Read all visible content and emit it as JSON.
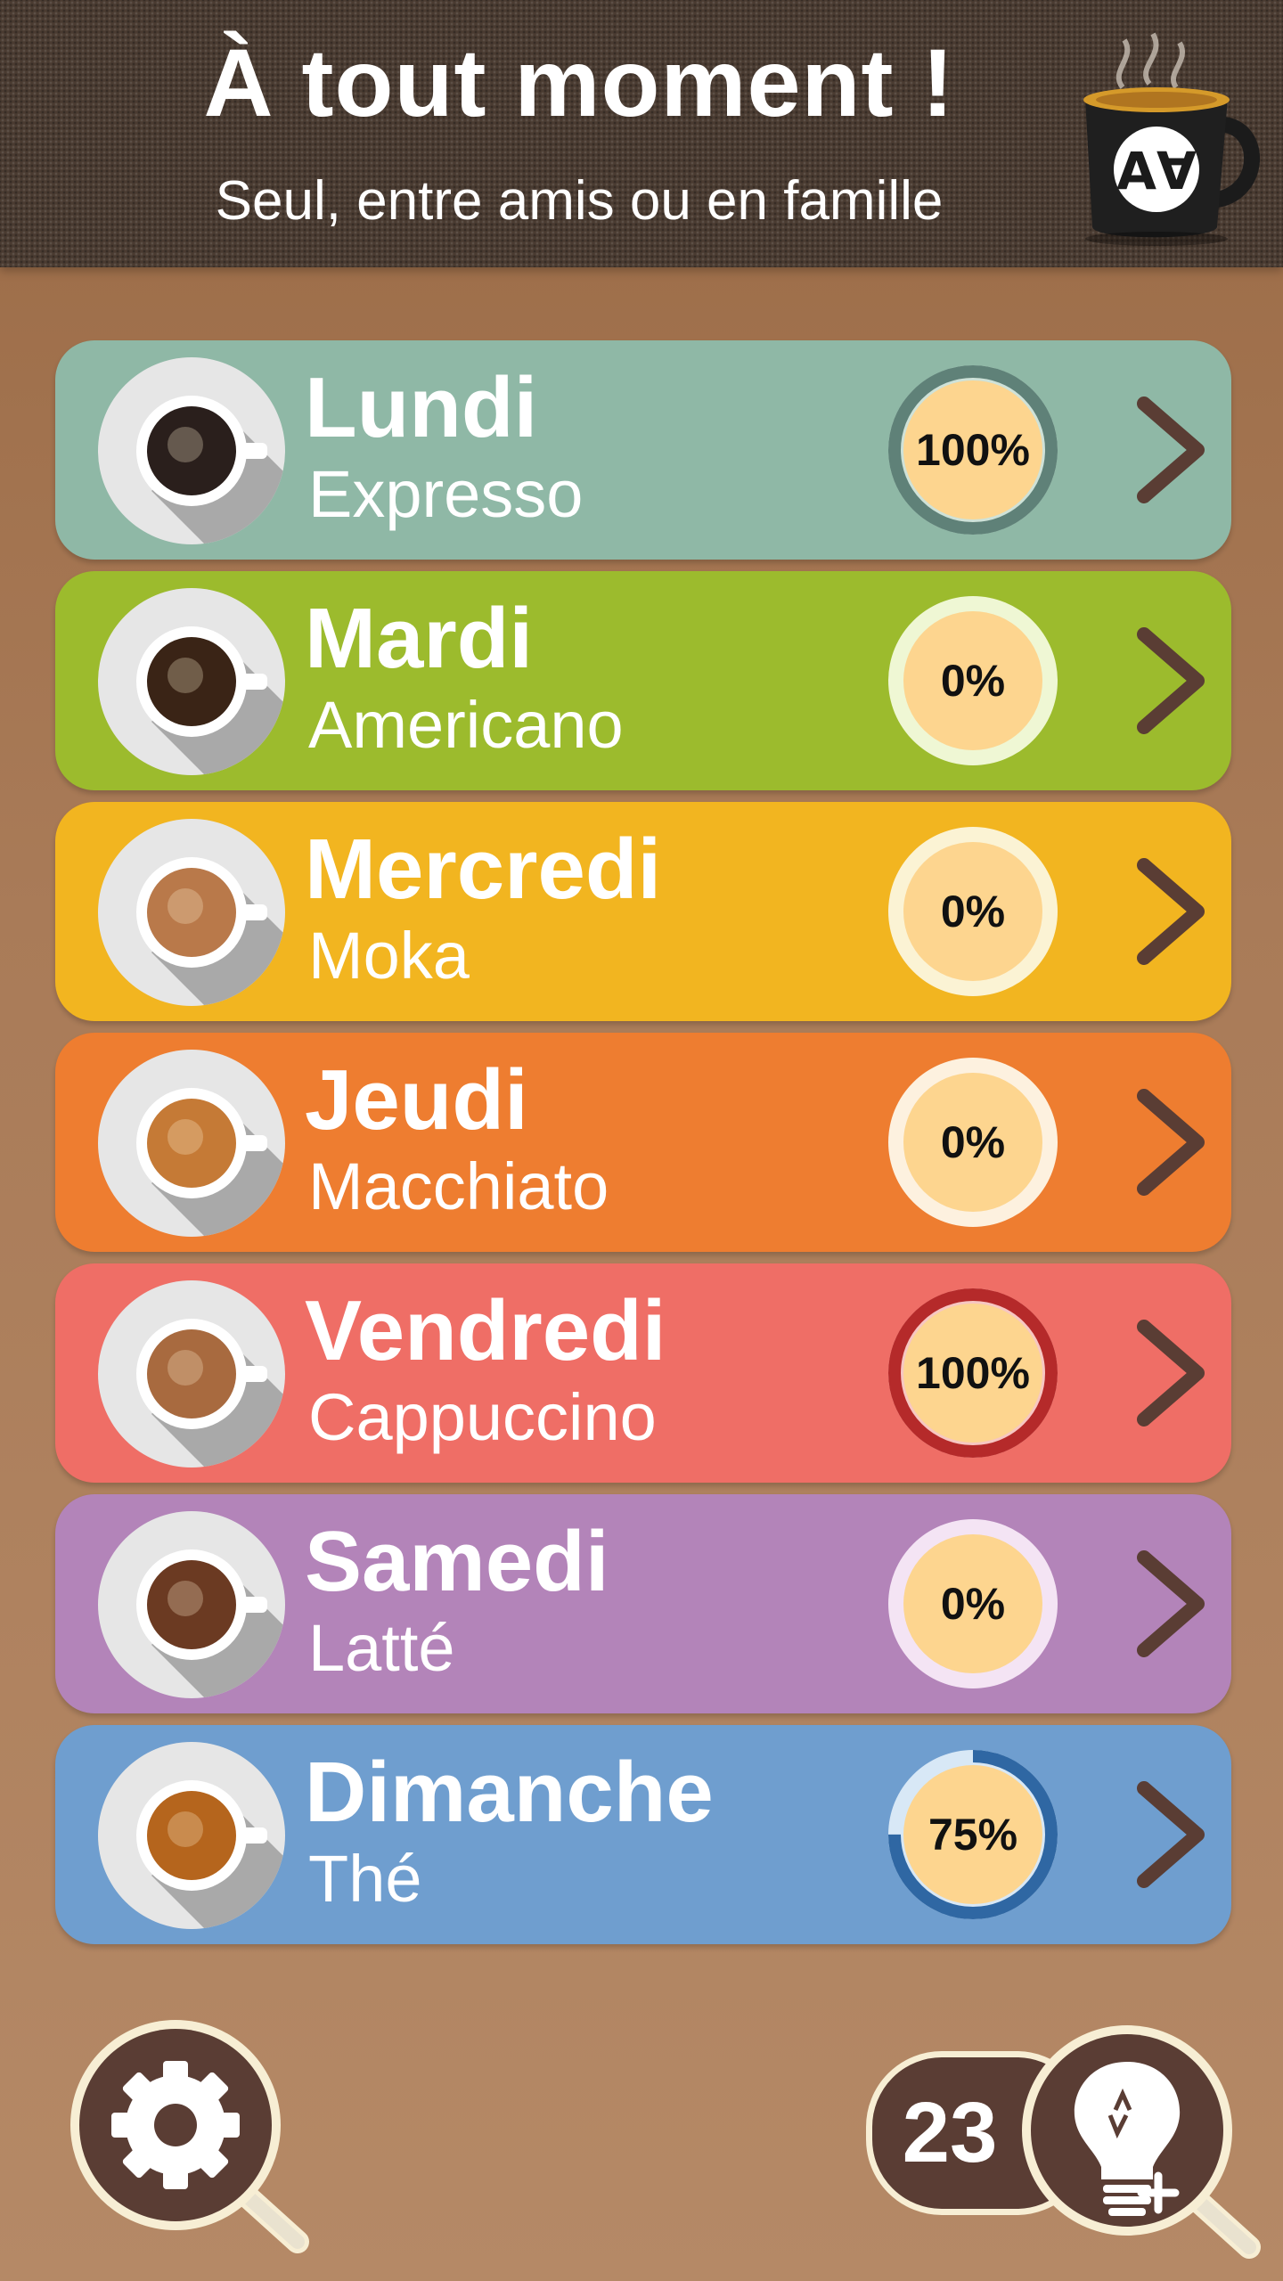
{
  "header": {
    "title": "À tout moment !",
    "subtitle": "Seul, entre amis ou en famille",
    "logo_icon": "coffee-cup-logo-icon",
    "logo_text": "A∀"
  },
  "levels": [
    {
      "day": "Lundi",
      "drink": "Expresso",
      "progress_label": "100%",
      "progress": 100,
      "bg_color": "#8fb8a6",
      "ring_color": "#5f8178",
      "ring_track": "#cfe2d8",
      "coffee_color": "#2a1f1c",
      "icon": "espresso-cup-icon"
    },
    {
      "day": "Mardi",
      "drink": "Americano",
      "progress_label": "0%",
      "progress": 0,
      "bg_color": "#9cbb2d",
      "ring_color": "#6e8f1a",
      "ring_track": "#eff7d4",
      "coffee_color": "#3a2416",
      "icon": "americano-cup-icon"
    },
    {
      "day": "Mercredi",
      "drink": "Moka",
      "progress_label": "0%",
      "progress": 0,
      "bg_color": "#f2b520",
      "ring_color": "#c88d0f",
      "ring_track": "#fbf3d4",
      "coffee_color": "#b9794a",
      "icon": "moka-cup-icon"
    },
    {
      "day": "Jeudi",
      "drink": "Macchiato",
      "progress_label": "0%",
      "progress": 0,
      "bg_color": "#ee7d30",
      "ring_color": "#c75f1a",
      "ring_track": "#fdf1df",
      "coffee_color": "#c57a36",
      "icon": "macchiato-cup-icon"
    },
    {
      "day": "Vendredi",
      "drink": "Cappuccino",
      "progress_label": "100%",
      "progress": 100,
      "bg_color": "#ef6e66",
      "ring_color": "#b52a2a",
      "ring_track": "#f7c7c2",
      "coffee_color": "#a86a3f",
      "icon": "cappuccino-cup-icon"
    },
    {
      "day": "Samedi",
      "drink": "Latté",
      "progress_label": "0%",
      "progress": 0,
      "bg_color": "#b384b9",
      "ring_color": "#8e5c96",
      "ring_track": "#f4e4f4",
      "coffee_color": "#6b3a22",
      "icon": "latte-cup-icon"
    },
    {
      "day": "Dimanche",
      "drink": "Thé",
      "progress_label": "75%",
      "progress": 75,
      "bg_color": "#6f9ecf",
      "ring_color": "#2f67a3",
      "ring_track": "#d8e8f6",
      "coffee_color": "#b5651d",
      "icon": "tea-cup-icon"
    }
  ],
  "bottom": {
    "settings_icon": "gear-icon",
    "hint_count": "23",
    "hint_icon": "lightbulb-plus-icon"
  },
  "colors": {
    "background": "#a97b58",
    "header_bg": "#4a3b31",
    "chevron": "#5a3d34",
    "progress_fill": "#fdd58f",
    "button_dark": "#5a3d34",
    "button_border": "#f7eed4"
  }
}
